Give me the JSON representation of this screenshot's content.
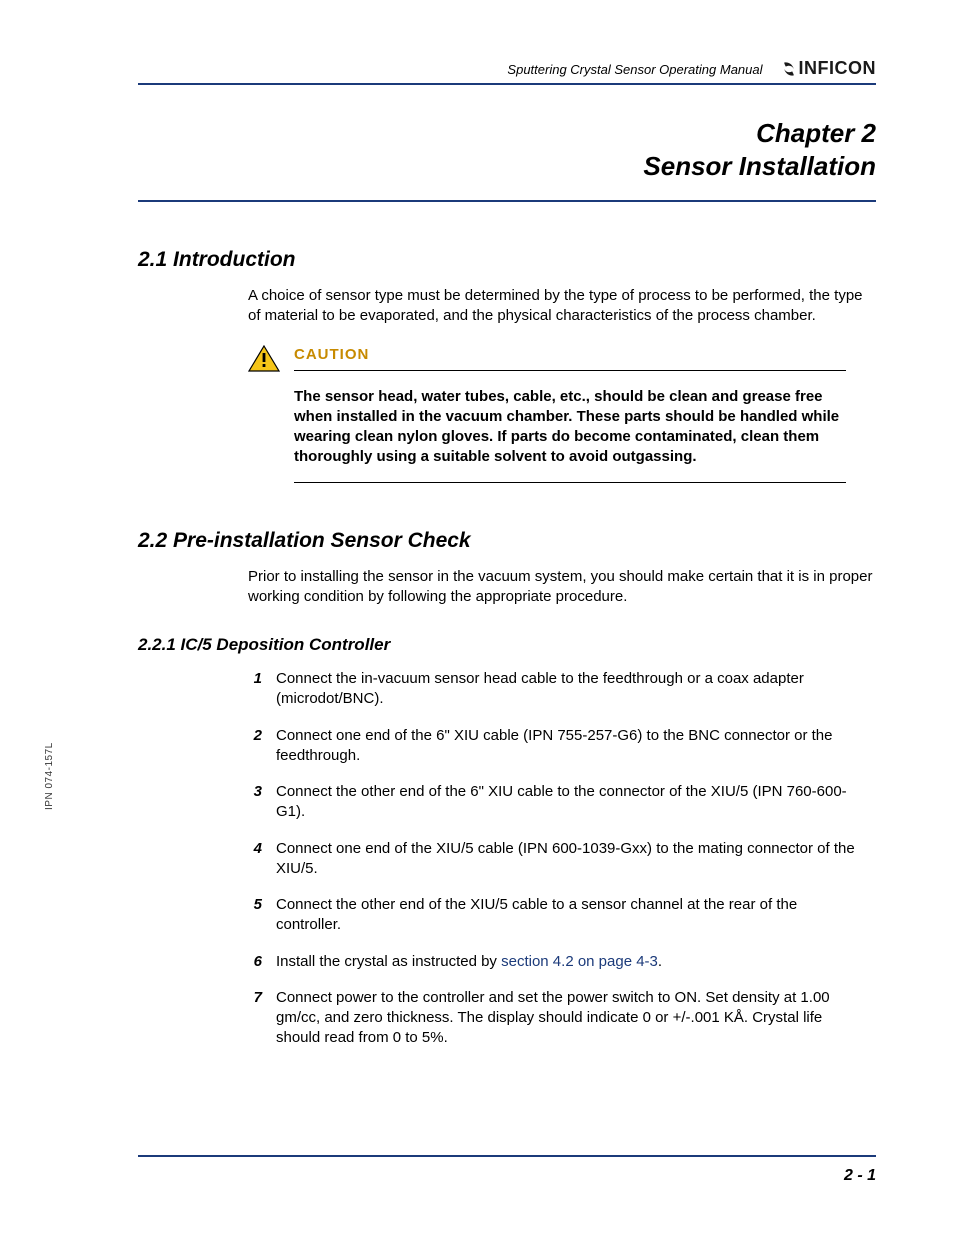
{
  "header": {
    "doc_title": "Sputtering Crystal Sensor Operating Manual",
    "brand": "INFICON"
  },
  "chapter": {
    "line1": "Chapter 2",
    "line2": "Sensor Installation"
  },
  "section_2_1": {
    "heading": "2.1  Introduction",
    "p1": "A choice of sensor type must be determined by the type of process to be performed, the type of material to be evaporated, and the physical characteristics of the process chamber."
  },
  "caution": {
    "label": "CAUTION",
    "body": "The sensor head, water tubes, cable, etc., should be clean and grease free when installed in the vacuum chamber. These parts should be handled while wearing clean nylon gloves. If parts do become contaminated, clean them thoroughly using a suitable solvent to avoid outgassing."
  },
  "section_2_2": {
    "heading": "2.2  Pre-installation Sensor Check",
    "p1": "Prior to installing the sensor in the vacuum system, you should make certain that it is in proper working condition by following the appropriate procedure."
  },
  "section_2_2_1": {
    "heading": "2.2.1  IC/5 Deposition Controller",
    "items": [
      "Connect the in-vacuum sensor head cable to the feedthrough or a coax adapter (microdot/BNC).",
      "Connect one end of the 6\" XIU cable (IPN 755-257-G6) to the BNC connector or the feedthrough.",
      "Connect the other end of the 6\" XIU cable to the connector of the XIU/5 (IPN 760-600-G1).",
      "Connect one end of the XIU/5 cable (IPN 600-1039-Gxx) to the mating connector of the XIU/5.",
      "Connect the other end of the XIU/5 cable to a sensor channel at the rear of the controller.",
      "Install the crystal as instructed by ",
      "Connect power to the controller and set the power switch to ON. Set density at 1.00 gm/cc, and zero thickness. The display should indicate 0 or +/-.001 KÅ. Crystal life should read from 0 to 5%."
    ],
    "item6_link": "section 4.2 on page 4-3",
    "item6_tail": "."
  },
  "side_label": "IPN 074-157L",
  "footer": {
    "page": "2 - 1"
  }
}
